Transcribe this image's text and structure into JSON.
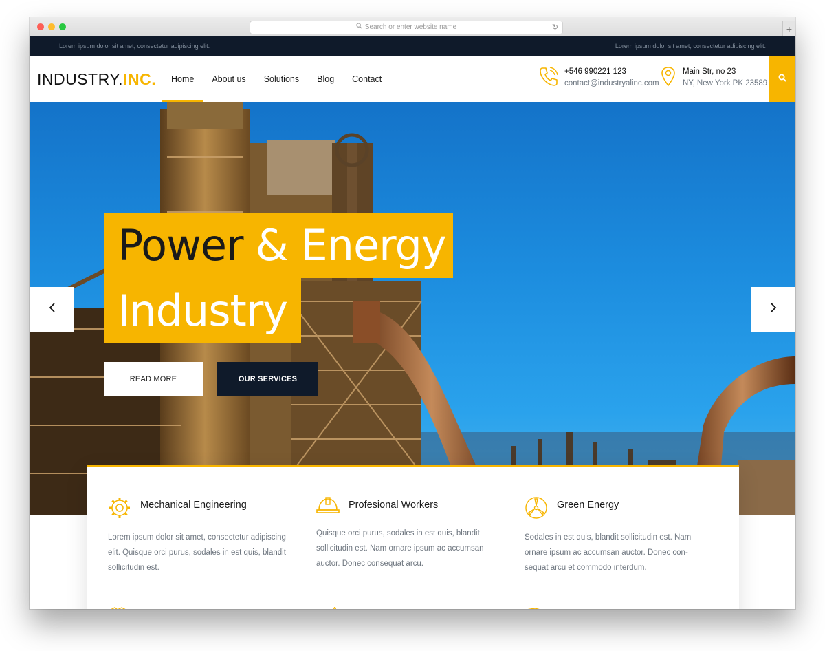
{
  "browser": {
    "address_placeholder": "Search or enter website name"
  },
  "topbar": {
    "left_text": "Lorem ipsum dolor sit amet, consectetur adipiscing elit.",
    "right_text": "Lorem ipsum dolor sit amet, consectetur adipiscing elit."
  },
  "navbar": {
    "logo_main": "INDUSTRY.",
    "logo_accent": "INC.",
    "menu": [
      {
        "label": "Home",
        "active": true
      },
      {
        "label": "About us"
      },
      {
        "label": "Solutions"
      },
      {
        "label": "Blog"
      },
      {
        "label": "Contact"
      }
    ],
    "phone": "+546 990221 123",
    "email": "contact@industryalinc.com",
    "address_line1": "Main Str, no 23",
    "address_line2": "NY, New York PK 23589",
    "accent_color": "#f7b500"
  },
  "hero": {
    "title_word1": "Power",
    "title_word2": "& Energy",
    "title_line2": "Industry",
    "read_more": "READ MORE",
    "our_services": "OUR SERVICES"
  },
  "services": [
    {
      "title": "Mechanical Engineering",
      "text": "Lorem ipsum dolor sit amet, consectetur adipiscing elit. Quisque orci purus, sodales in est quis, blandit sollicitudin est.",
      "icon": "gear-icon"
    },
    {
      "title": "Profesional Workers",
      "text": "Quisque orci purus, sodales in est quis, blandit sollicitudin est. Nam ornare ipsum ac accumsan auctor. Donec consequat arcu.",
      "icon": "hard-hat-icon"
    },
    {
      "title": "Green Energy",
      "text": "Sodales in est quis, blandit sollicitudin est. Nam ornare ipsum ac accumsan auctor. Donec con-sequat arcu et commodo interdum.",
      "icon": "wind-turbine-icon"
    }
  ]
}
